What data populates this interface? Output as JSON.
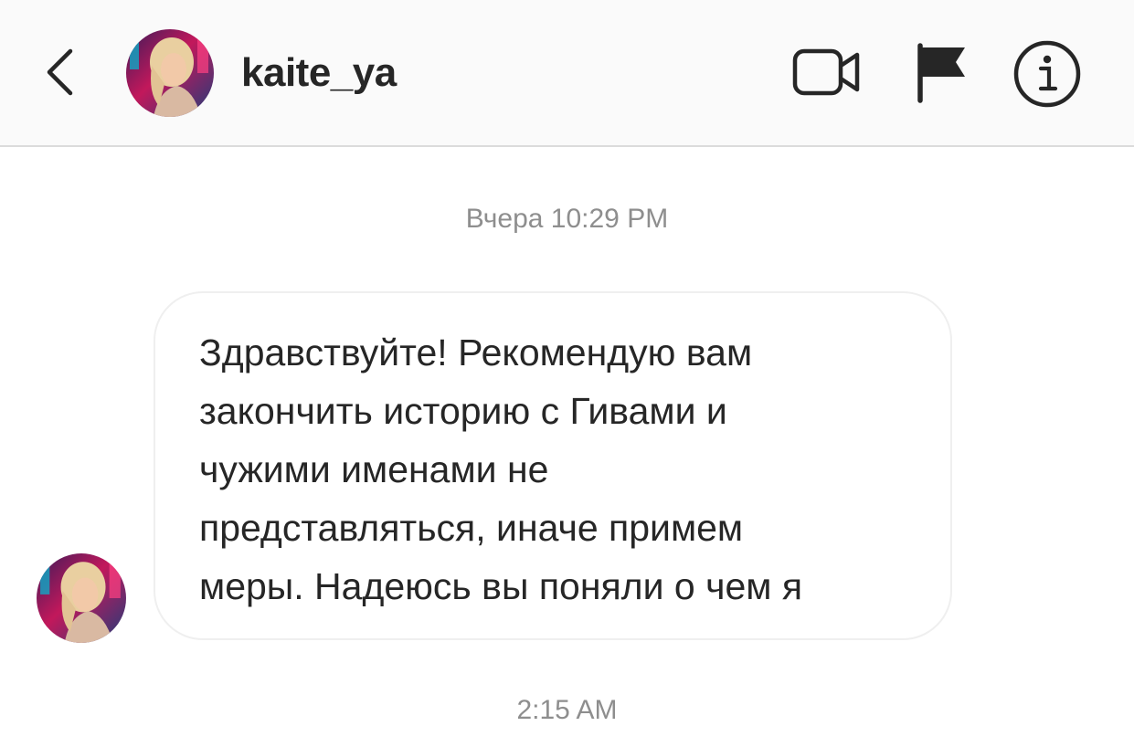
{
  "header": {
    "username": "kaite_ya",
    "back_icon": "chevron-left-icon",
    "video_icon": "video-camera-icon",
    "flag_icon": "flag-icon",
    "info_icon": "info-icon"
  },
  "thread": {
    "timestamp_1": "Вчера 10:29 PM",
    "message_text": "Здравствуйте! Рекомендую вам\nзакончить историю с Гивами и\nчужими именами не\nпредставляться, иначе примем\nмеры. Надеюсь вы поняли о чем я",
    "timestamp_2": "2:15 AM"
  },
  "colors": {
    "header_bg": "#fafafa",
    "divider": "#dbdbdb",
    "text_primary": "#262626",
    "text_secondary": "#8e8e8e",
    "bubble_border": "#efefef"
  }
}
